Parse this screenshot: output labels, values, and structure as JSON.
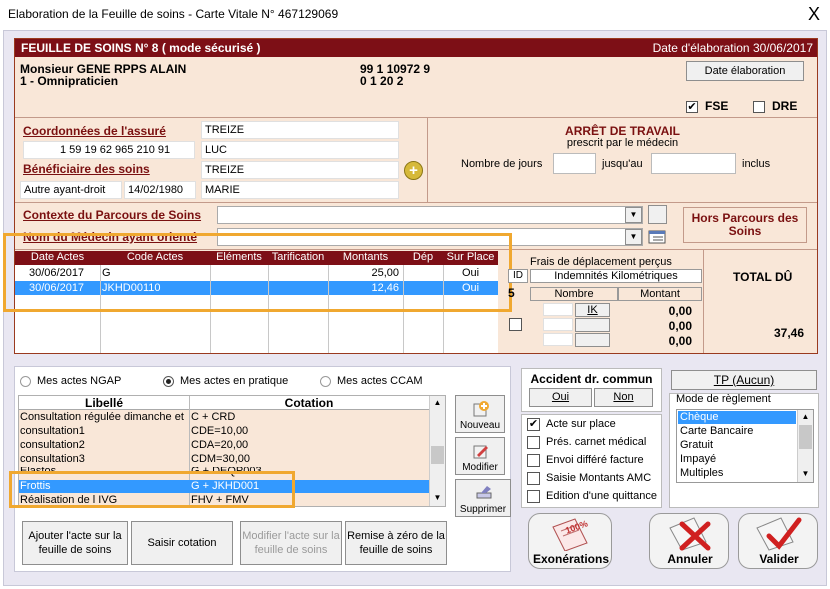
{
  "window": {
    "title": "Elaboration de la Feuille de soins - Carte Vitale N° 467129069",
    "close": "X"
  },
  "header": {
    "title": "FEUILLE DE SOINS  N° 8 ( mode sécurisé )",
    "date": "Date d'élaboration 30/06/2017"
  },
  "doctor": {
    "name": "Monsieur GENE RPPS ALAIN",
    "specialty": "1 - Omnipraticien",
    "id1": "99 1 10972 9",
    "id2": "0 1 20 2"
  },
  "date_button": "Date élaboration",
  "fse": {
    "label": "FSE",
    "checked": "✔"
  },
  "dre": {
    "label": "DRE"
  },
  "assure": {
    "coords_label": "Coordonnées de l'assuré",
    "name": "TREIZE",
    "number": "1 59 19 62 965 210 91",
    "firstname": "LUC",
    "benef_label": "Bénéficiaire des soins",
    "benef_name": "TREIZE",
    "ayant_droit": "Autre ayant-droit",
    "birth": "14/02/1980",
    "benef_firstname": "MARIE"
  },
  "arret": {
    "title": "ARRÊT DE TRAVAIL",
    "subtitle": "prescrit par le médecin",
    "jours": "Nombre de jours",
    "jusquau": "jusqu'au",
    "inclus": "inclus"
  },
  "parcours": {
    "contexte": "Contexte du Parcours de Soins",
    "medecin": "Nom du Médecin ayant orienté",
    "hors": "Hors Parcours des Soins"
  },
  "acts_table": {
    "headers": [
      "Date Actes",
      "Code Actes",
      "Eléments",
      "Tarification",
      "Montants",
      "Dép",
      "Sur Place"
    ],
    "rows": [
      [
        "30/06/2017",
        "G",
        "",
        "",
        "25,00",
        "",
        "Oui"
      ],
      [
        "30/06/2017",
        "JKHD00110",
        "",
        "",
        "12,46",
        "",
        "Oui"
      ]
    ]
  },
  "frais": {
    "title": "Frais de déplacement perçus",
    "id": "ID",
    "ik_label": "Indemnités Kilométriques",
    "nombre": "Nombre",
    "montant": "Montant",
    "digit": "5",
    "ik": "IK",
    "m1": "0,00",
    "m2": "0,00",
    "m3": "0,00"
  },
  "total": {
    "label": "TOTAL DÛ",
    "value": "37,46"
  },
  "tabs": {
    "ngap": "Mes actes NGAP",
    "pratique": "Mes actes en pratique",
    "ccam": "Mes actes CCAM"
  },
  "list": {
    "headers": [
      "Libellé",
      "Cotation"
    ],
    "rows": [
      [
        "Consultation régulée dimanche et I",
        "C + CRD"
      ],
      [
        "consultation1",
        "CDE=10,00"
      ],
      [
        "consultation2",
        "CDA=20,00"
      ],
      [
        "consultation3",
        "CDM=30,00"
      ],
      [
        "Elastos",
        "G + DEQP003"
      ],
      [
        "Frottis",
        "G + JKHD001"
      ],
      [
        "Réalisation de l IVG",
        "FHV + FMV"
      ]
    ]
  },
  "side_buttons": {
    "nouveau": "Nouveau",
    "modifier": "Modifier",
    "supprimer": "Supprimer"
  },
  "bottom_buttons": {
    "ajouter": "Ajouter l'acte sur la feuille de soins",
    "saisir": "Saisir cotation",
    "modifier": "Modifier l'acte sur la feuille de soins",
    "remise": "Remise à zéro de la feuille de soins"
  },
  "accident": {
    "title": "Accident dr. commun",
    "oui": "Oui",
    "non": "Non"
  },
  "options": [
    {
      "label": "Acte sur place",
      "checked": "✔"
    },
    {
      "label": "Prés. carnet médical"
    },
    {
      "label": "Envoi différé facture"
    },
    {
      "label": "Saisie Montants AMC"
    },
    {
      "label": "Edition d'une quittance"
    }
  ],
  "tp": "TP (Aucun)",
  "reglement": {
    "title": "Mode de règlement",
    "items": [
      "Chèque",
      "Carte Bancaire",
      "Gratuit",
      "Impayé",
      "Multiples"
    ]
  },
  "actions": {
    "exo": "Exonérations",
    "exo_badge": "100%",
    "annuler": "Annuler",
    "valider": "Valider"
  },
  "colors": {
    "brand": "#7d0f16",
    "selection": "#3399ff",
    "highlight": "#f0a830"
  }
}
